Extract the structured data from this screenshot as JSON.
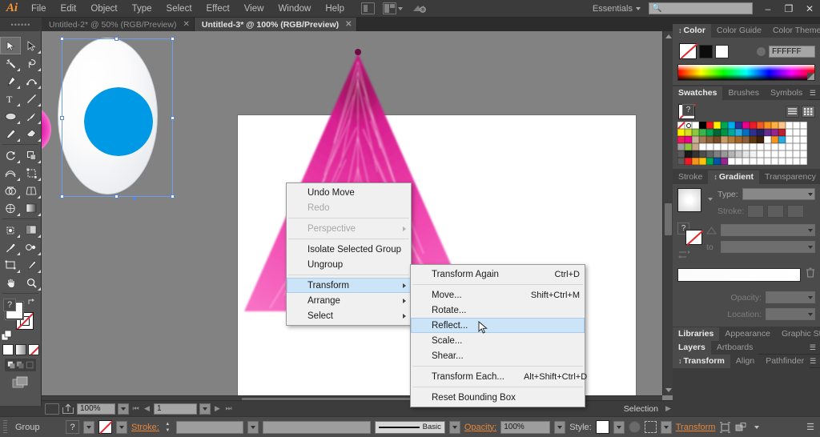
{
  "app": {
    "logo": "Ai",
    "menus": [
      "File",
      "Edit",
      "Object",
      "Type",
      "Select",
      "Effect",
      "View",
      "Window",
      "Help"
    ],
    "workspace": "Essentials",
    "search_placeholder": "",
    "window_buttons": {
      "minimize": "–",
      "restore": "❐",
      "close": "✕"
    }
  },
  "tabs": {
    "grip": "••••••",
    "items": [
      {
        "label": "Untitled-2* @ 50% (RGB/Preview)",
        "close": "✕",
        "active": false
      },
      {
        "label": "Untitled-3* @ 100% (RGB/Preview)",
        "close": "✕",
        "active": true
      }
    ]
  },
  "toolbar": {
    "tools": [
      "selection-tool",
      "direct-selection-tool",
      "magic-wand-tool",
      "lasso-tool",
      "pen-tool",
      "curvature-tool",
      "type-tool",
      "line-segment-tool",
      "ellipse-tool",
      "paintbrush-tool",
      "pencil-tool",
      "eraser-tool",
      "rotate-tool",
      "scale-tool",
      "width-tool",
      "free-transform-tool",
      "shape-builder-tool",
      "perspective-grid-tool",
      "mesh-tool",
      "gradient-tool",
      "eyedropper-tool",
      "blend-tool",
      "symbol-sprayer-tool",
      "column-graph-tool",
      "artboard-tool",
      "slice-tool",
      "hand-tool",
      "zoom-tool"
    ],
    "fill_color": "#FFFFFF",
    "stroke_color": "none",
    "question_glyph": "?",
    "fill_stroke_modes": [
      "color-fill-mode",
      "gradient-fill-mode",
      "none-fill-mode"
    ],
    "draw_modes": [
      "draw-normal",
      "draw-behind",
      "draw-inside"
    ],
    "screen_mode": "change-screen-mode"
  },
  "canvas": {
    "background": "#828282",
    "artboard_color": "#FFFFFF",
    "artwork": {
      "sphere": {
        "name": "pink-gradient-sphere",
        "colors": [
          "#8c1a1a",
          "#e020ad",
          "#ffffff"
        ]
      },
      "ellipse": {
        "name": "selected-ellipse",
        "fill": "#f2f4f6"
      },
      "dome": {
        "name": "blue-dome-shape",
        "fill": "#0099E5"
      },
      "fur": {
        "name": "pink-fur-cone",
        "color": "#ED3AA8"
      }
    },
    "selection_color": "#5b86d6"
  },
  "context_menu": {
    "items": [
      {
        "label": "Undo Move",
        "accel": "",
        "disabled": false,
        "submenu": false,
        "highlighted": false,
        "sep_after": false
      },
      {
        "label": "Redo",
        "accel": "",
        "disabled": true,
        "submenu": false,
        "highlighted": false,
        "sep_after": true
      },
      {
        "label": "Perspective",
        "accel": "",
        "disabled": true,
        "submenu": true,
        "highlighted": false,
        "sep_after": true
      },
      {
        "label": "Isolate Selected Group",
        "accel": "",
        "disabled": false,
        "submenu": false,
        "highlighted": false,
        "sep_after": false
      },
      {
        "label": "Ungroup",
        "accel": "",
        "disabled": false,
        "submenu": false,
        "highlighted": false,
        "sep_after": true
      },
      {
        "label": "Transform",
        "accel": "",
        "disabled": false,
        "submenu": true,
        "highlighted": true,
        "sep_after": false
      },
      {
        "label": "Arrange",
        "accel": "",
        "disabled": false,
        "submenu": true,
        "highlighted": false,
        "sep_after": false
      },
      {
        "label": "Select",
        "accel": "",
        "disabled": false,
        "submenu": true,
        "highlighted": false,
        "sep_after": false
      }
    ]
  },
  "transform_submenu": {
    "items": [
      {
        "label": "Transform Again",
        "accel": "Ctrl+D",
        "highlighted": false,
        "sep_after": true
      },
      {
        "label": "Move...",
        "accel": "Shift+Ctrl+M",
        "highlighted": false,
        "sep_after": false
      },
      {
        "label": "Rotate...",
        "accel": "",
        "highlighted": false,
        "sep_after": false
      },
      {
        "label": "Reflect...",
        "accel": "",
        "highlighted": true,
        "sep_after": false
      },
      {
        "label": "Scale...",
        "accel": "",
        "highlighted": false,
        "sep_after": false
      },
      {
        "label": "Shear...",
        "accel": "",
        "highlighted": false,
        "sep_after": true
      },
      {
        "label": "Transform Each...",
        "accel": "Alt+Shift+Ctrl+D",
        "highlighted": false,
        "sep_after": true
      },
      {
        "label": "Reset Bounding Box",
        "accel": "",
        "highlighted": false,
        "sep_after": false
      }
    ]
  },
  "panels": {
    "color": {
      "tabs": [
        "Color",
        "Color Guide",
        "Color Themes"
      ],
      "active_tab": "Color",
      "hex_value": "FFFFFF",
      "fill_swatch": "none",
      "black_swatch": "#000000",
      "white_swatch": "#FFFFFF"
    },
    "swatches": {
      "tabs": [
        "Swatches",
        "Brushes",
        "Symbols"
      ],
      "active_tab": "Swatches",
      "question_glyph": "?",
      "rows": [
        [
          "none",
          "registration",
          "#FFFFFF",
          "#000000",
          "#ED1C24",
          "#FFF200",
          "#00A651",
          "#00AEEF",
          "#2E3192",
          "#EC008C",
          "#ED1C24",
          "#F05A28",
          "#F7941E",
          "#FBB040",
          "#FDC689",
          "#FFFFFF",
          "#FFFFFF",
          "#FFFFFF"
        ],
        [
          "#FFF200",
          "#D7DF23",
          "#8DC63F",
          "#39B54A",
          "#00A651",
          "#006838",
          "#009444",
          "#00A79D",
          "#27AAE1",
          "#0071BC",
          "#2E3192",
          "#262262",
          "#662D91",
          "#92278F",
          "#BE1E2D",
          "#FFFFFF",
          "#FFFFFF",
          "#FFFFFF"
        ],
        [
          "#ED1C5B",
          "#EC008C",
          "#C7B299",
          "#A67C52",
          "#8C6239",
          "#754C24",
          "#C69C6D",
          "#B47C3E",
          "#A3682A",
          "#8B5E3C",
          "#603913",
          "#42210B",
          "#FFFFFF",
          "#F7941E",
          "#29ABE2",
          "#FFFFFF",
          "#FFFFFF",
          "#FFFFFF"
        ],
        [
          "#9E9E9E",
          "#8DC63F",
          "#C8A88A",
          "#FFFFFF",
          "#FFFFFF",
          "#FFFFFF",
          "#FFFFFF",
          "#FFFFFF",
          "#FFFFFF",
          "#FFFFFF",
          "#FFFFFF",
          "#FFFFFF",
          "#FFFFFF",
          "#FFFFFF",
          "#FFFFFF",
          "#FFFFFF",
          "#FFFFFF",
          "#FFFFFF"
        ],
        [
          "#5A5A5A",
          "#1A1A1A",
          "#333333",
          "#4D4D4D",
          "#666666",
          "#808080",
          "#999999",
          "#B3B3B3",
          "#CCCCCC",
          "#E6E6E6",
          "#F2F2F2",
          "#FFFFFF",
          "#FFFFFF",
          "#FFFFFF",
          "#FFFFFF",
          "#FFFFFF",
          "#FFFFFF",
          "#FFFFFF"
        ],
        [
          "#5A5A5A",
          "#ED1C24",
          "#F7941E",
          "#FFC20E",
          "#00A651",
          "#0054A6",
          "#92278F",
          "#FFFFFF",
          "#FFFFFF",
          "#FFFFFF",
          "#FFFFFF",
          "#FFFFFF",
          "#FFFFFF",
          "#FFFFFF",
          "#FFFFFF",
          "#FFFFFF",
          "#FFFFFF",
          "#FFFFFF"
        ]
      ]
    },
    "gradient": {
      "tabs": [
        "Stroke",
        "Gradient",
        "Transparency"
      ],
      "active_tab": "Gradient",
      "type_label": "Type:",
      "type_value": "",
      "stroke_label": "Stroke:",
      "angle_label": "",
      "to_label": "",
      "opacity_label": "Opacity:",
      "opacity_value": "",
      "location_label": "Location:",
      "location_value": "",
      "question_glyph": "?"
    },
    "libraries": {
      "tabs": [
        "Libraries",
        "Appearance",
        "Graphic Styles"
      ],
      "active_tab": "Libraries"
    },
    "layers": {
      "tabs": [
        "Layers",
        "Artboards"
      ],
      "active_tab": "Layers"
    },
    "transform": {
      "tabs": [
        "Transform",
        "Align",
        "Pathfinder"
      ],
      "active_tab": "Transform"
    }
  },
  "statusbar": {
    "zoom": "100%",
    "page": "1",
    "status_text": "Selection"
  },
  "control_bar": {
    "object_label": "Group",
    "question_glyph": "?",
    "stroke_label": "Stroke:",
    "stroke_weight": "",
    "stroke_profile": "",
    "brush_label": "Basic",
    "opacity_label": "Opacity:",
    "opacity_value": "100%",
    "style_label": "Style:",
    "transform_label": "Transform"
  }
}
